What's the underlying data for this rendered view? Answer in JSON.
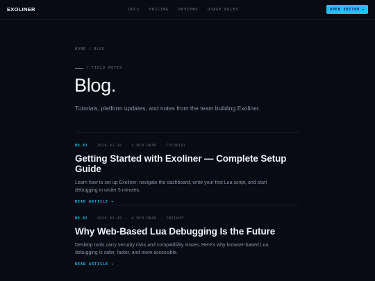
{
  "nav": {
    "brand": "EXOLINER",
    "links": [
      "DOCS",
      "PRICING",
      "REVIEWS",
      "USAGE RULES"
    ],
    "cta_label": "OPEN EDITOR",
    "cta_arrow": "→"
  },
  "breadcrumb": {
    "home": "HOME",
    "separator": "/",
    "current": "BLOG"
  },
  "eyebrow": "/ FIELD NOTES",
  "page_title": "Blog.",
  "lead": "Tutorials, platform updates, and notes from the team building Exoliner.",
  "posts": [
    {
      "number": "NO.03",
      "date": "2026-02-26",
      "read_time": "5 MIN READ",
      "tag": "TUTORIAL",
      "title": "Getting Started with Exoliner — Complete Setup Guide",
      "excerpt": "Learn how to set up Exoliner, navigate the dashboard, write your first Lua script, and start debugging in under 5 minutes.",
      "read_more": "READ ARTICLE →"
    },
    {
      "number": "NO.02",
      "date": "2026-02-20",
      "read_time": "4 MIN READ",
      "tag": "INSIGHT",
      "title": "Why Web-Based Lua Debugging Is the Future",
      "excerpt": "Desktop tools carry security risks and compatibility issues. Here's why browser-based Lua debugging is safer, faster, and more accessible.",
      "read_more": "READ ARTICLE →"
    }
  ]
}
